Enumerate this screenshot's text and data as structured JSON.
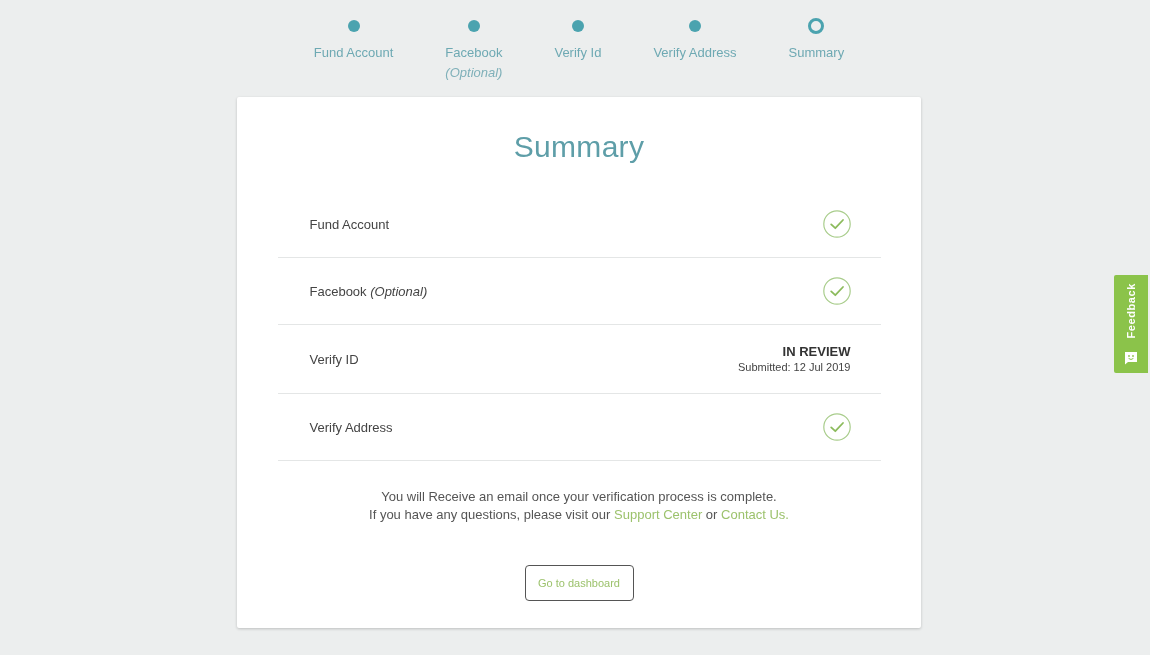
{
  "stepper": {
    "steps": [
      {
        "label": "Fund Account",
        "current": false
      },
      {
        "label": "Facebook",
        "note": "(Optional)",
        "current": false
      },
      {
        "label": "Verify Id",
        "current": false
      },
      {
        "label": "Verify Address",
        "current": false
      },
      {
        "label": "Summary",
        "current": true
      }
    ]
  },
  "card": {
    "title": "Summary",
    "rows": [
      {
        "kind": "check",
        "label": "Fund Account"
      },
      {
        "kind": "check",
        "label": "Facebook *(Optional)*"
      },
      {
        "kind": "status",
        "label": "Verify ID",
        "status": "IN REVIEW",
        "submitted": "Submitted: 12 Jul 2019"
      },
      {
        "kind": "check",
        "label": "Verify Address"
      }
    ],
    "info_text": "You will Receive an email once your verification process is complete.",
    "help_text": [
      {
        "kind": "text",
        "text": "If you have any questions, please visit our"
      },
      {
        "kind": "link",
        "text": "Support Center"
      },
      {
        "kind": "text",
        "text": "or"
      },
      {
        "kind": "link",
        "text": "Contact Us."
      }
    ],
    "button": "Go to dashboard"
  },
  "feedback_tab": {
    "label": "Feedback"
  }
}
